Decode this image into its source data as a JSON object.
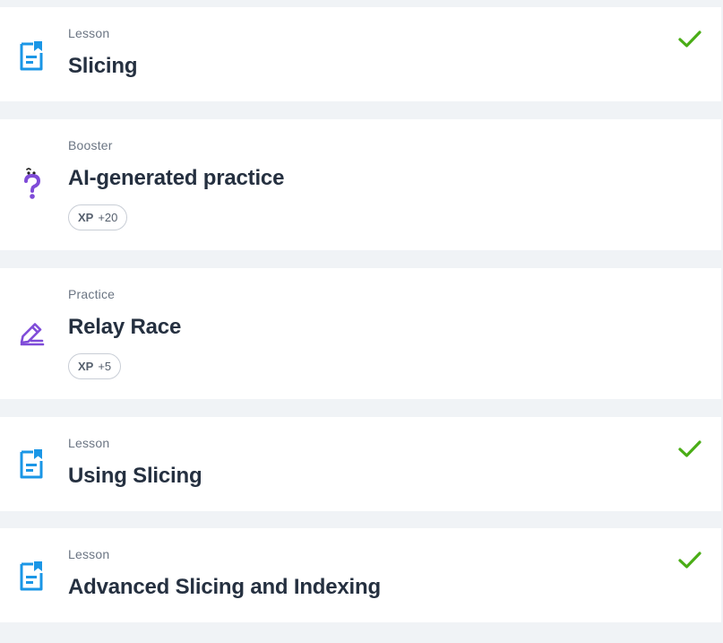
{
  "items": [
    {
      "type": "Lesson",
      "title": "Slicing",
      "icon": "lesson-document-icon",
      "completed": true
    },
    {
      "type": "Booster",
      "title": "AI-generated practice",
      "icon": "question-mark-icon",
      "xp_label": "XP",
      "xp_value": "+20"
    },
    {
      "type": "Practice",
      "title": "Relay Race",
      "icon": "pencil-icon",
      "xp_label": "XP",
      "xp_value": "+5"
    },
    {
      "type": "Lesson",
      "title": "Using Slicing",
      "icon": "lesson-document-icon",
      "completed": true
    },
    {
      "type": "Lesson",
      "title": "Advanced Slicing and Indexing",
      "icon": "lesson-document-icon",
      "completed": true
    }
  ],
  "colors": {
    "lesson_icon": "#1a96e6",
    "booster_icon": "#7f4bd8",
    "practice_icon": "#7f4bd8",
    "check": "#4aad16",
    "background": "#f0f3f6"
  }
}
